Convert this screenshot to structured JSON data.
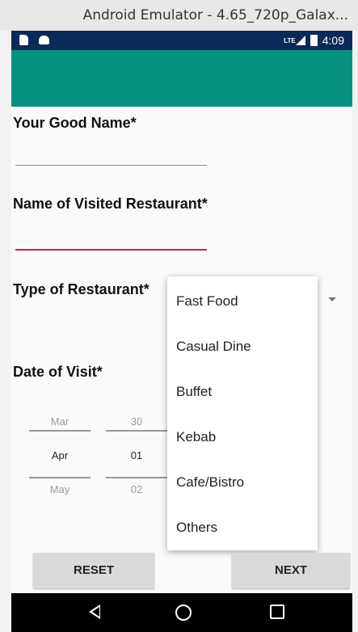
{
  "window": {
    "title": "Android Emulator - 4.65_720p_Galax..."
  },
  "status": {
    "network": "LTE",
    "time": "4:09"
  },
  "form": {
    "name_label": "Your Good Name*",
    "restaurant_label": "Name of Visited Restaurant*",
    "type_label": "Type of Restaurant*",
    "date_label": "Date of Visit*"
  },
  "date_picker": {
    "months": [
      "Mar",
      "Apr",
      "May"
    ],
    "days": [
      "30",
      "01",
      "02"
    ]
  },
  "dropdown": {
    "options": [
      "Fast Food",
      "Casual Dine",
      "Buffet",
      "Kebab",
      "Cafe/Bistro",
      "Others"
    ]
  },
  "buttons": {
    "reset": "RESET",
    "next": "NEXT"
  },
  "colors": {
    "appbar": "#05917e",
    "statusbar": "#0b2a5c",
    "focus_underline": "#d81b60"
  }
}
